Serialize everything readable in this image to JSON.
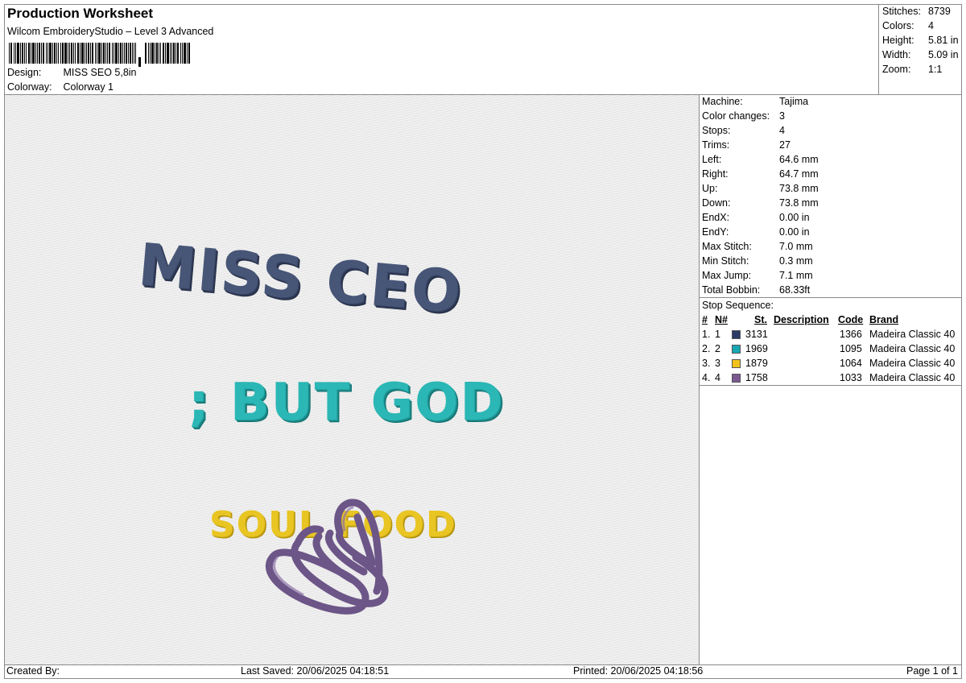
{
  "header": {
    "title": "Production Worksheet",
    "subtitle": "Wilcom EmbroideryStudio – Level 3 Advanced",
    "design_label": "Design:",
    "design_value": "MISS SEO 5,8in",
    "colorway_label": "Colorway:",
    "colorway_value": "Colorway 1"
  },
  "summary": {
    "stitches_label": "Stitches:",
    "stitches": "8739",
    "colors_label": "Colors:",
    "colors": "4",
    "height_label": "Height:",
    "height": "5.81 in",
    "width_label": "Width:",
    "width": "5.09 in",
    "zoom_label": "Zoom:",
    "zoom": "1:1"
  },
  "design_text": {
    "line1": "MISS CEO",
    "line2": "; BUT GOD",
    "line3": "SOUL FOOD"
  },
  "machine_info": [
    {
      "label": "Machine:",
      "value": "Tajima"
    },
    {
      "label": "Color changes:",
      "value": "3"
    },
    {
      "label": "Stops:",
      "value": "4"
    },
    {
      "label": "Trims:",
      "value": "27"
    },
    {
      "label": "Left:",
      "value": "64.6 mm"
    },
    {
      "label": "Right:",
      "value": "64.7 mm"
    },
    {
      "label": "Up:",
      "value": "73.8 mm"
    },
    {
      "label": "Down:",
      "value": "73.8 mm"
    },
    {
      "label": "EndX:",
      "value": "0.00 in"
    },
    {
      "label": "EndY:",
      "value": "0.00 in"
    },
    {
      "label": "Max Stitch:",
      "value": "7.0 mm"
    },
    {
      "label": "Min Stitch:",
      "value": "0.3 mm"
    },
    {
      "label": "Max Jump:",
      "value": "7.1 mm"
    },
    {
      "label": "Total Bobbin:",
      "value": "68.33ft"
    }
  ],
  "stop_sequence": {
    "title": "Stop Sequence:",
    "headers": {
      "num": "#",
      "n": "N#",
      "st": "St.",
      "description": "Description",
      "code": "Code",
      "brand": "Brand"
    },
    "rows": [
      {
        "num": "1.",
        "n": "1",
        "color": "#2b3a66",
        "st": "3131",
        "code": "1366",
        "brand": "Madeira Classic 40"
      },
      {
        "num": "2.",
        "n": "2",
        "color": "#17a8b4",
        "st": "1969",
        "code": "1095",
        "brand": "Madeira Classic 40"
      },
      {
        "num": "3.",
        "n": "3",
        "color": "#f2c21c",
        "st": "1879",
        "code": "1064",
        "brand": "Madeira Classic 40"
      },
      {
        "num": "4.",
        "n": "4",
        "color": "#7b5a92",
        "st": "1758",
        "code": "1033",
        "brand": "Madeira Classic 40"
      }
    ]
  },
  "footer": {
    "created_by": "Created By:",
    "last_saved": "Last Saved: 20/06/2025 04:18:51",
    "printed": "Printed: 20/06/2025 04:18:56",
    "page": "Page 1 of 1"
  }
}
